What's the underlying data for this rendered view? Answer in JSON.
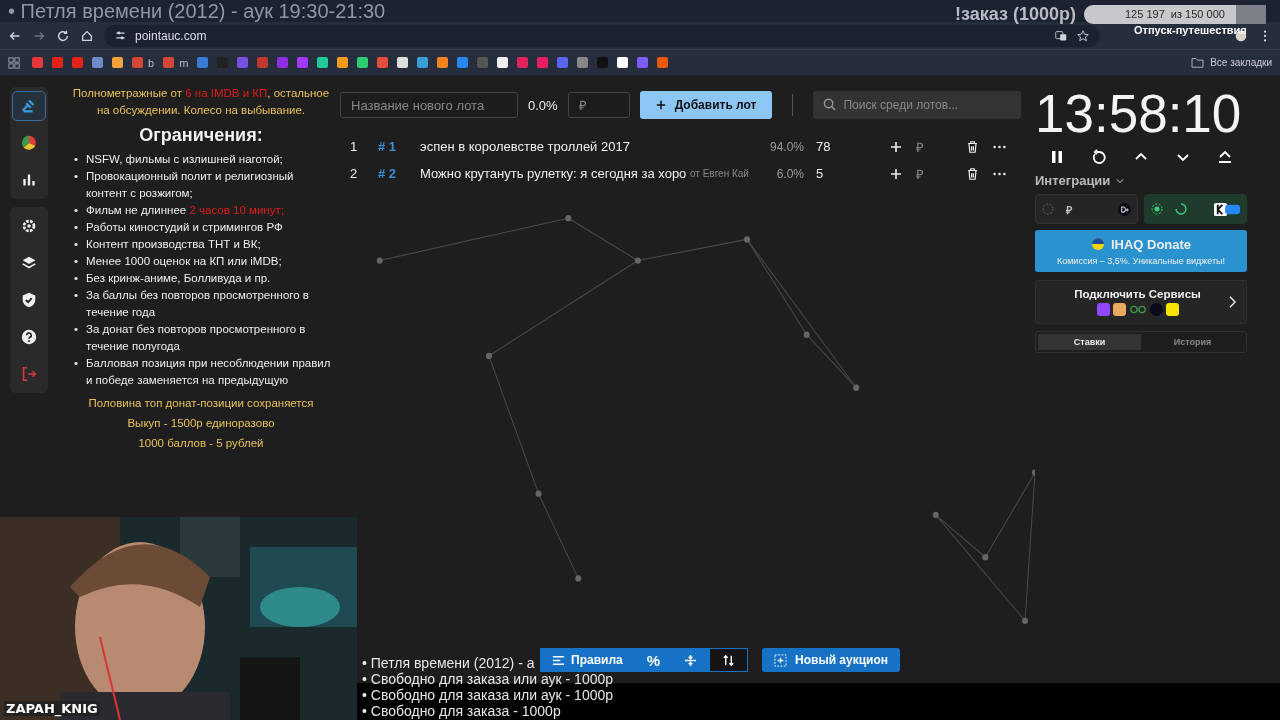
{
  "stream_overlay": {
    "title": "• Петля времени (2012) - аук 19:30-21:30",
    "command": "!заказ (1000р)",
    "goal": {
      "reading": "125 197  из 150 000",
      "level": 0.835,
      "label": "Отпуск-путешествия"
    },
    "camera_name": "ZAPAH_KNIG",
    "queue": [
      "• Петля времени (2012) - а",
      "• Свободно для заказа или аук - 1000р",
      "• Свободно для заказа или аук - 1000р",
      "• Свободно для заказа - 1000р"
    ]
  },
  "browser": {
    "url": "pointauc.com",
    "bookmarks": [
      {
        "label": "b"
      },
      {
        "label": "m"
      }
    ],
    "all_bookmarks": "Все закладки"
  },
  "sidebar": {
    "groups": [
      {
        "items": [
          {
            "kind": "gavel",
            "selected": true
          },
          {
            "kind": "pie",
            "selected": false
          },
          {
            "kind": "bars",
            "selected": false
          }
        ]
      },
      {
        "items": [
          {
            "kind": "gear",
            "selected": false
          },
          {
            "kind": "layers",
            "selected": false
          },
          {
            "kind": "shield",
            "selected": false
          },
          {
            "kind": "help",
            "selected": false
          },
          {
            "kind": "logout",
            "selected": false
          }
        ]
      }
    ]
  },
  "rules": {
    "intro": [
      {
        "text": "Полнометражные от ",
        "highlight": false
      },
      {
        "text": "6 на IMDB и КП",
        "highlight": true
      },
      {
        "text": ", остальное на обсуждении. Колесо на выбывание.",
        "highlight": false
      }
    ],
    "heading": "Ограничения:",
    "bullet": "•",
    "items": [
      [
        {
          "text": "NSFW, фильмы с излишней наготой;",
          "highlight": false
        }
      ],
      [
        {
          "text": "Провокационный полит и религиозный контент с розжигом;",
          "highlight": false
        }
      ],
      [
        {
          "text": "Фильм не длиннее ",
          "highlight": false
        },
        {
          "text": "2 часов 10 минут;",
          "highlight": true
        }
      ],
      [
        {
          "text": "Работы киностудий и стримингов РФ",
          "highlight": false
        }
      ],
      [
        {
          "text": "Контент производства ТНТ и ВК;",
          "highlight": false
        }
      ],
      [
        {
          "text": "Менее 1000 оценок на КП или iMDB;",
          "highlight": false
        }
      ],
      [
        {
          "text": "Без кринж-аниме, Болливуда и пр.",
          "highlight": false
        }
      ],
      [
        {
          "text": "За баллы без повторов просмотренного в течение года",
          "highlight": false
        }
      ],
      [
        {
          "text": "За донат без повторов просмотренного в течение полугода",
          "highlight": false
        }
      ],
      [
        {
          "text": "Балловая позиция при несоблюдении правил и победе заменяется на предыдущую",
          "highlight": false
        }
      ]
    ],
    "footer": [
      "Половина топ донат-позиции сохраняется",
      "Выкуп - 1500р единоразово",
      "1000 баллов - 5 рублей"
    ]
  },
  "new_lot": {
    "name_placeholder": "Название нового лота",
    "percent": "0.0%",
    "amount_placeholder": "₽",
    "add_button": "Добавить лот",
    "search_placeholder": "Поиск среди лотов..."
  },
  "lots": [
    {
      "index": "1",
      "id": "# 1",
      "name": "эспен в королевстве троллей 2017",
      "percent": "94.0%",
      "amount": "78",
      "currency": "₽"
    },
    {
      "index": "2",
      "id": "# 2",
      "name": "Можно крутануть рулетку: я сегодня за хоро",
      "author": "от Евген Кай",
      "percent": "6.0%",
      "amount": "5",
      "currency": "₽"
    }
  ],
  "timer": "13:58:10",
  "integrations": {
    "label": "Интеграции",
    "cards": [
      {
        "active": false,
        "currency": "₽"
      },
      {
        "active": true
      }
    ]
  },
  "donate": {
    "title": "IHAQ Donate",
    "subtitle": "Комиссия – 3,5%. Уникальные виджеты!"
  },
  "connect_services": "Подключить Сервисы",
  "tabs": [
    {
      "label": "Ставки",
      "selected": true
    },
    {
      "label": "История",
      "selected": false
    }
  ],
  "toolbar": [
    {
      "kind": "rules",
      "label": "Правила",
      "selected": false
    },
    {
      "kind": "percent",
      "label": "%",
      "selected": false
    },
    {
      "kind": "compress",
      "selected": false
    },
    {
      "kind": "sort",
      "selected": true
    }
  ],
  "new_auction": "Новый аукцион"
}
